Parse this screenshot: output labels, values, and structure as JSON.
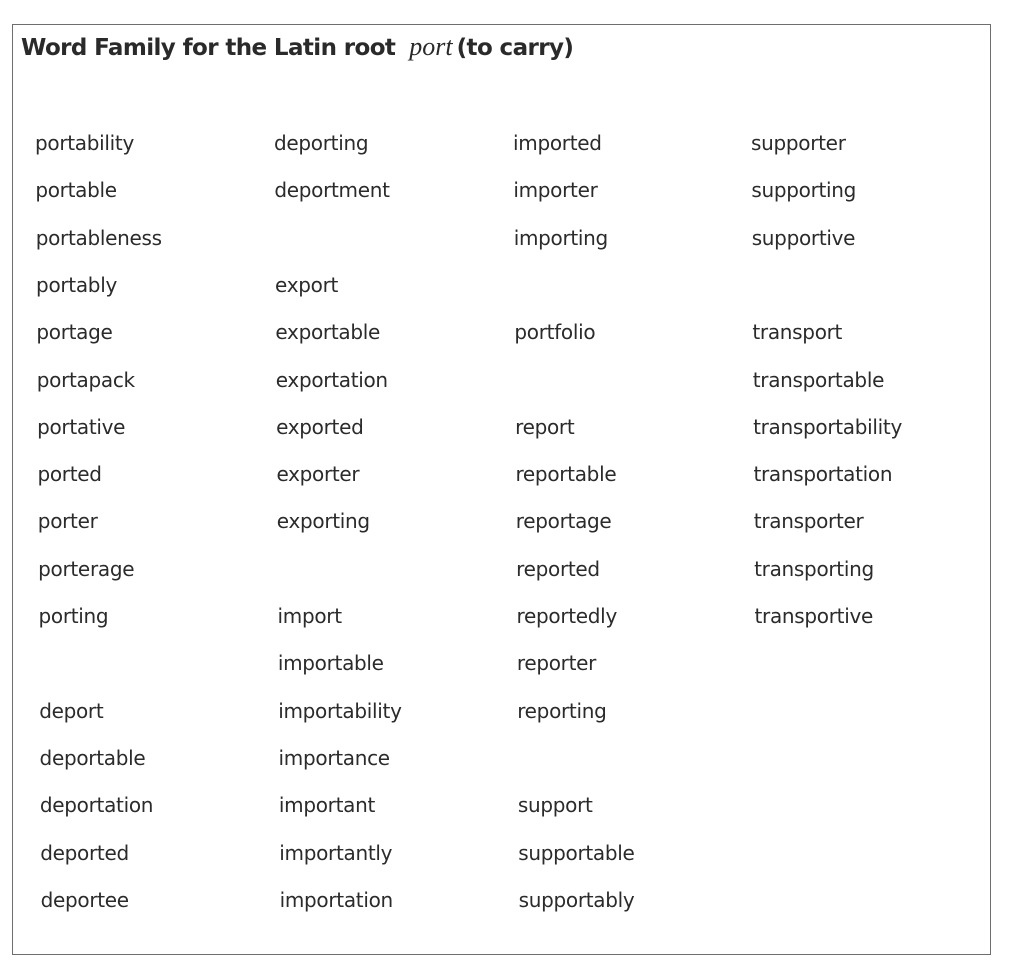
{
  "title": {
    "prefix": "Word Family for the Latin root",
    "root": "port",
    "gloss": "(to carry)"
  },
  "columns": [
    {
      "words": [
        "portability",
        "portable",
        "portableness",
        "portably",
        "portage",
        "portapack",
        "portative",
        "ported",
        "porter",
        "porterage",
        "porting",
        "",
        "deport",
        "deportable",
        "deportation",
        "deported",
        "deportee"
      ]
    },
    {
      "words": [
        "deporting",
        "deportment",
        "",
        "export",
        "exportable",
        "exportation",
        "exported",
        "exporter",
        "exporting",
        "",
        "import",
        "importable",
        "importability",
        "importance",
        "important",
        "importantly",
        "importation"
      ]
    },
    {
      "words": [
        "imported",
        "importer",
        "importing",
        "",
        "portfolio",
        "",
        "report",
        "reportable",
        "reportage",
        "reported",
        "reportedly",
        "reporter",
        "reporting",
        "",
        "support",
        "supportable",
        "supportably"
      ]
    },
    {
      "words": [
        "supporter",
        "supporting",
        "supportive",
        "",
        "transport",
        "transportable",
        "transportability",
        "transportation",
        "transporter",
        "transporting",
        "transportive",
        "",
        "",
        "",
        "",
        "",
        ""
      ]
    }
  ]
}
